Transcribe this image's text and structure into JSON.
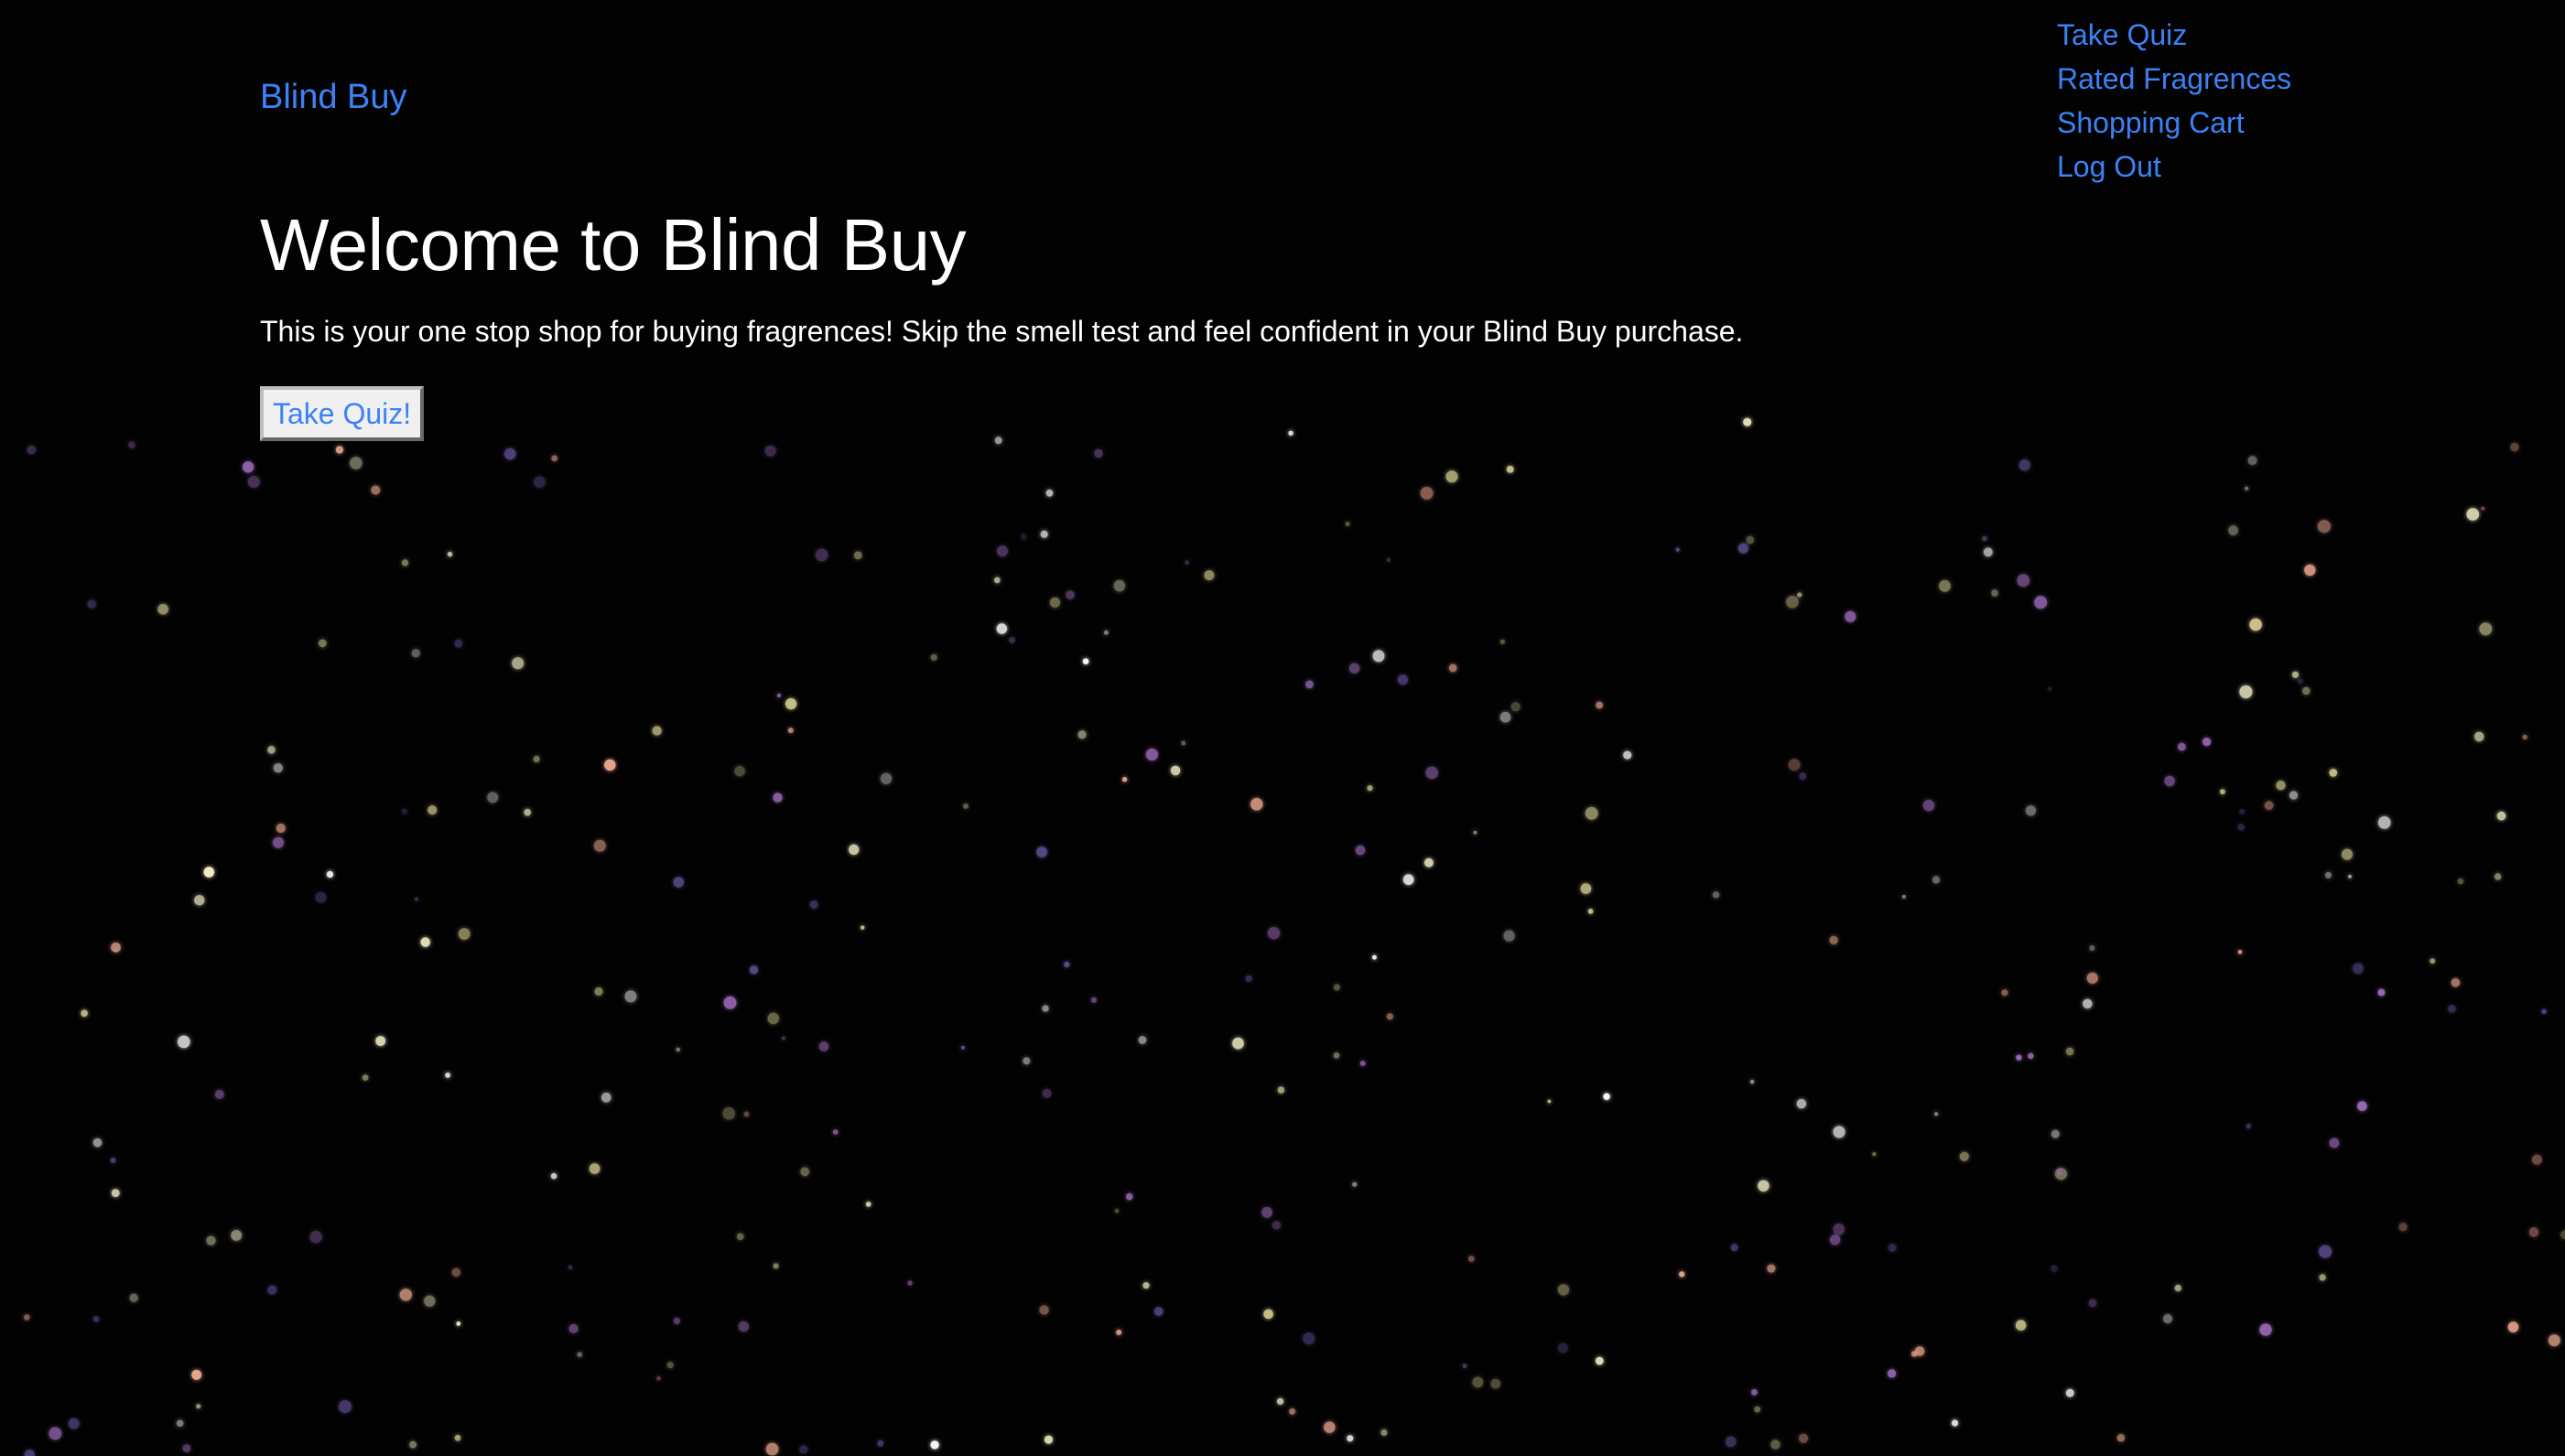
{
  "header": {
    "brand": "Blind Buy"
  },
  "nav": {
    "items": [
      {
        "label": "Take Quiz"
      },
      {
        "label": "Rated Fragrences"
      },
      {
        "label": "Shopping Cart"
      },
      {
        "label": "Log Out"
      }
    ]
  },
  "hero": {
    "title": "Welcome to Blind Buy",
    "description": "This is your one stop shop for buying fragrences! Skip the smell test and feel confident in your Blind Buy purchase.",
    "cta_label": "Take Quiz!"
  },
  "theme": {
    "background": "#020202",
    "link_color": "#3b82f6",
    "text_color": "#ffffff",
    "star_colors": [
      "#f5f0c8",
      "#e8a48c",
      "#9a6ab8",
      "#c7c08a",
      "#ffffff",
      "#5a4a8a"
    ]
  }
}
